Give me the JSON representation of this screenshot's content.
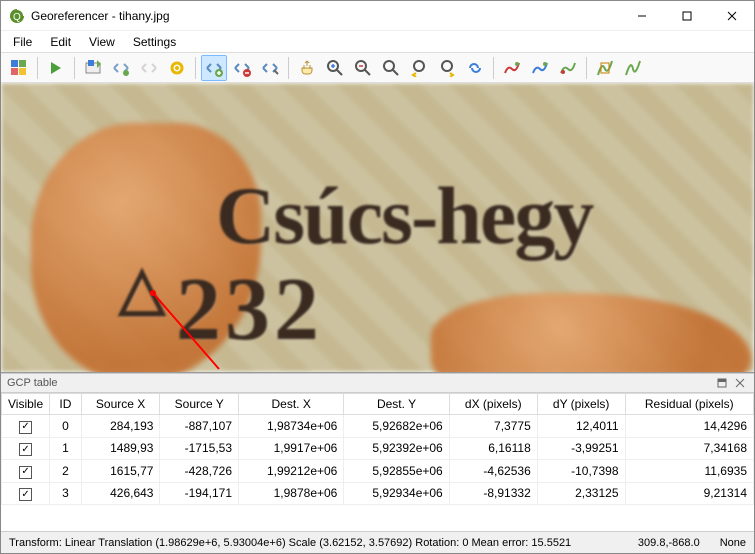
{
  "window": {
    "title": "Georeferencer - tihany.jpg"
  },
  "menu": {
    "file": "File",
    "edit": "Edit",
    "view": "View",
    "settings": "Settings"
  },
  "toolbar_icons": {
    "open": "open-raster-icon",
    "run": "run-icon",
    "save": "save-gcp-icon",
    "load": "load-gcp-icon",
    "next": "next-icon",
    "gear": "settings-gear-icon",
    "addpt": "add-point-icon",
    "delpt": "delete-point-icon",
    "movept": "move-point-icon",
    "pan": "pan-icon",
    "zoomin": "zoom-in-icon",
    "zoomout": "zoom-out-icon",
    "zoomlayer": "zoom-to-layer-icon",
    "zoomlast": "zoom-last-icon",
    "zoomnext": "zoom-next-icon",
    "link": "link-georef-icon",
    "hist1": "histogram1-icon",
    "hist2": "histogram2-icon",
    "hist3": "histogram3-icon",
    "hs1": "local-hist-icon",
    "hs2": "full-hist-icon"
  },
  "map": {
    "label_top": "Csúcs-hegy",
    "label_num": "232",
    "triangle": "△"
  },
  "gcp_panel": {
    "title": "GCP table"
  },
  "table": {
    "headers": {
      "visible": "Visible",
      "id": "ID",
      "srcx": "Source X",
      "srcy": "Source Y",
      "destx": "Dest. X",
      "desty": "Dest. Y",
      "dx": "dX (pixels)",
      "dy": "dY (pixels)",
      "residual": "Residual (pixels)"
    },
    "rows": [
      {
        "id": "0",
        "srcx": "284,193",
        "srcy": "-887,107",
        "destx": "1,98734e+06",
        "desty": "5,92682e+06",
        "dx": "7,3775",
        "dy": "12,4011",
        "res": "14,4296"
      },
      {
        "id": "1",
        "srcx": "1489,93",
        "srcy": "-1715,53",
        "destx": "1,9917e+06",
        "desty": "5,92392e+06",
        "dx": "6,16118",
        "dy": "-3,99251",
        "res": "7,34168"
      },
      {
        "id": "2",
        "srcx": "1615,77",
        "srcy": "-428,726",
        "destx": "1,99212e+06",
        "desty": "5,92855e+06",
        "dx": "-4,62536",
        "dy": "-10,7398",
        "res": "11,6935"
      },
      {
        "id": "3",
        "srcx": "426,643",
        "srcy": "-194,171",
        "destx": "1,9878e+06",
        "desty": "5,92934e+06",
        "dx": "-8,91332",
        "dy": "2,33125",
        "res": "9,21314"
      }
    ]
  },
  "status": {
    "transform": "Transform: Linear Translation (1.98629e+6, 5.93004e+6) Scale (3.62152, 3.57692) Rotation: 0 Mean error: 15.5521",
    "coords": "309.8,-868.0",
    "extra": "None"
  }
}
